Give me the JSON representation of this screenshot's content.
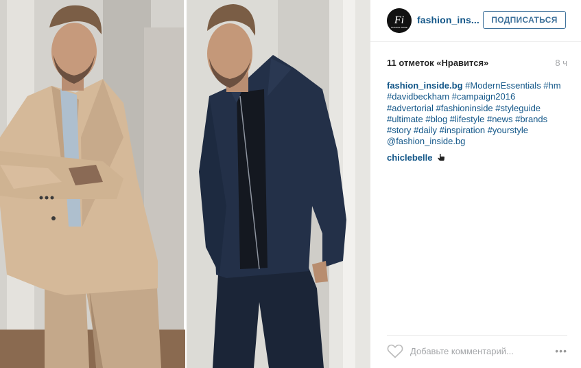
{
  "post": {
    "image_alt": "Fashion campaign photo: man in beige suit and man in navy jacket"
  },
  "header": {
    "avatar_text": "Fi",
    "avatar_subtext": "FASHION INSIDE",
    "username": "fashion_ins...",
    "follow_label": "ПОДПИСАТЬСЯ"
  },
  "stats": {
    "likes": "11 отметок «Нравится»",
    "time": "8 ч"
  },
  "caption": {
    "author": "fashion_inside.bg",
    "lines": [
      "#ModernEssentials #hm",
      "#davidbeckham #campaign2016",
      "#advertorial #fashioninside #styleguide",
      "#ultimate #blog #lifestyle #news #brands",
      "#story #daily #inspiration #yourstyle",
      "@fashion_inside.bg"
    ]
  },
  "comment": {
    "user": "chiclebelle",
    "emoji": "hand-pointing-icon"
  },
  "footer": {
    "comment_placeholder": "Добавьте комментарий...",
    "more_label": "•••"
  },
  "colors": {
    "link": "#125688",
    "button": "#3f729b",
    "muted": "#a5a7aa"
  }
}
